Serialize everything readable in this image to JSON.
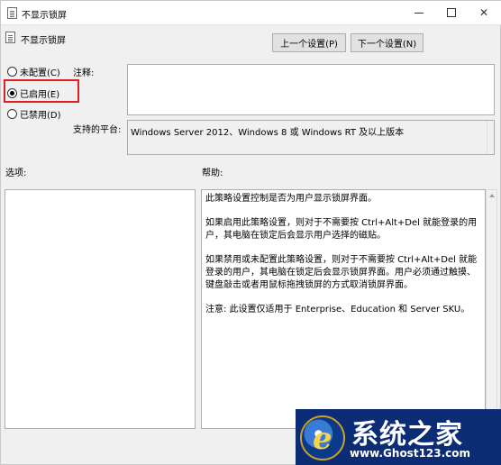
{
  "window": {
    "title": "不显示锁屏",
    "minimize_icon": "minimize-icon",
    "maximize_icon": "maximize-icon",
    "close_icon": "close-icon"
  },
  "policy": {
    "title": "不显示锁屏",
    "icon": "policy-settings-icon"
  },
  "nav": {
    "prev_label": "上一个设置(P)",
    "next_label": "下一个设置(N)"
  },
  "state": {
    "options": [
      {
        "label": "未配置(C)",
        "checked": false
      },
      {
        "label": "已启用(E)",
        "checked": true
      },
      {
        "label": "已禁用(D)",
        "checked": false
      }
    ],
    "highlight_color": "#e02020"
  },
  "fields": {
    "comment_label": "注释:",
    "comment_value": "",
    "platform_label": "支持的平台:",
    "platform_value": "Windows Server 2012、Windows 8 或 Windows RT 及以上版本"
  },
  "panes": {
    "options_label": "选项:",
    "help_label": "帮助:",
    "help_paragraphs": [
      "此策略设置控制是否为用户显示锁屏界面。",
      "如果启用此策略设置，则对于不需要按 Ctrl+Alt+Del 就能登录的用户，其电脑在锁定后会显示用户选择的磁贴。",
      "如果禁用或未配置此策略设置，则对于不需要按 Ctrl+Alt+Del 就能登录的用户，其电脑在锁定后会显示锁屏界面。用户必须通过触摸、键盘敲击或者用鼠标拖拽锁屏的方式取消锁屏界面。",
      "注意: 此设置仅适用于 Enterprise、Education 和 Server SKU。"
    ]
  },
  "watermark": {
    "title": "系统之家",
    "url": "www.Ghost123.com",
    "bg_color": "#0c2d75"
  }
}
